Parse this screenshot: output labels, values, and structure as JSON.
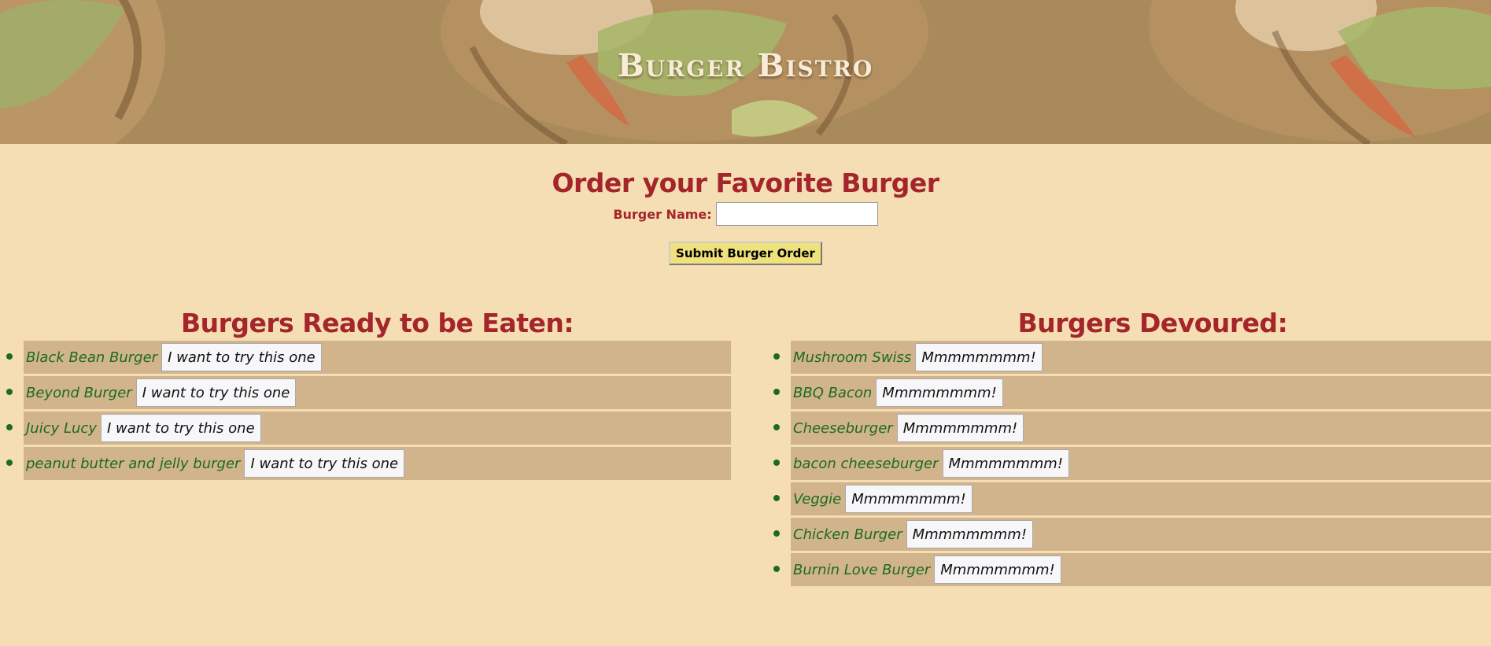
{
  "header": {
    "title": "Burger Bistro"
  },
  "order_form": {
    "heading": "Order your Favorite Burger",
    "name_label": "Burger Name:",
    "name_value": "",
    "submit_label": "Submit Burger Order"
  },
  "ready": {
    "heading": "Burgers Ready to be Eaten:",
    "action_label": "I want to try this one",
    "items": [
      {
        "name": "Black Bean Burger"
      },
      {
        "name": "Beyond Burger"
      },
      {
        "name": "Juicy Lucy"
      },
      {
        "name": "peanut butter and jelly burger"
      }
    ]
  },
  "devoured": {
    "heading": "Burgers Devoured:",
    "action_label": "Mmmmmmmm!",
    "items": [
      {
        "name": "Mushroom Swiss"
      },
      {
        "name": "BBQ Bacon"
      },
      {
        "name": "Cheeseburger"
      },
      {
        "name": "bacon cheeseburger"
      },
      {
        "name": "Veggie"
      },
      {
        "name": "Chicken Burger"
      },
      {
        "name": "Burnin Love Burger"
      }
    ]
  },
  "colors": {
    "page_background": "#f5deb3",
    "heading_red": "#a4262c",
    "item_background": "#d2b48c",
    "burger_name_green": "#1c6b1c",
    "submit_yellow": "#efe27d"
  }
}
